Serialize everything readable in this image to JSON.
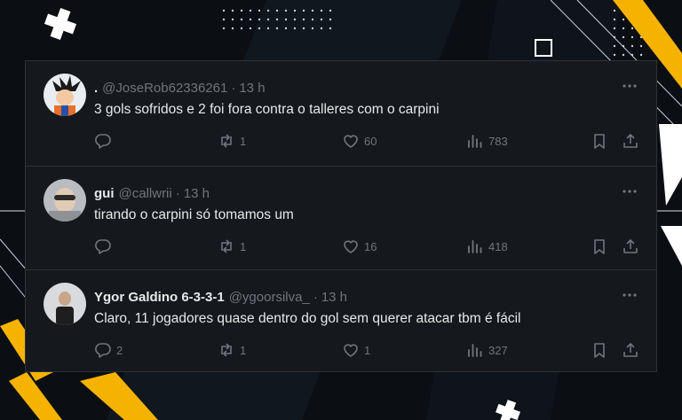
{
  "colors": {
    "background": "#0b0e13",
    "card": "#15181c",
    "border": "#2f3336",
    "text": "#e7e9ea",
    "muted": "#71767b",
    "accent_yellow": "#f5b300"
  },
  "tweets": [
    {
      "name": ".",
      "handle": "@JoseRob62336261",
      "time": "13 h",
      "text": "3 gols sofridos e 2 foi fora contra o talleres com o carpini",
      "replies": "",
      "retweets": "1",
      "likes": "60",
      "views": "783"
    },
    {
      "name": "gui",
      "handle": "@callwrii",
      "time": "13 h",
      "text": "tirando o carpini só tomamos um",
      "replies": "",
      "retweets": "1",
      "likes": "16",
      "views": "418"
    },
    {
      "name": "Ygor Galdino 6-3-3-1",
      "handle": "@ygoorsilva_",
      "time": "13 h",
      "text": "Claro, 11 jogadores quase dentro do gol sem querer atacar tbm é fácil",
      "replies": "2",
      "retweets": "1",
      "likes": "1",
      "views": "327"
    }
  ],
  "icons": {
    "reply": "reply-icon",
    "retweet": "retweet-icon",
    "like": "like-icon",
    "views": "views-icon",
    "bookmark": "bookmark-icon",
    "share": "share-icon",
    "more": "more-icon"
  }
}
